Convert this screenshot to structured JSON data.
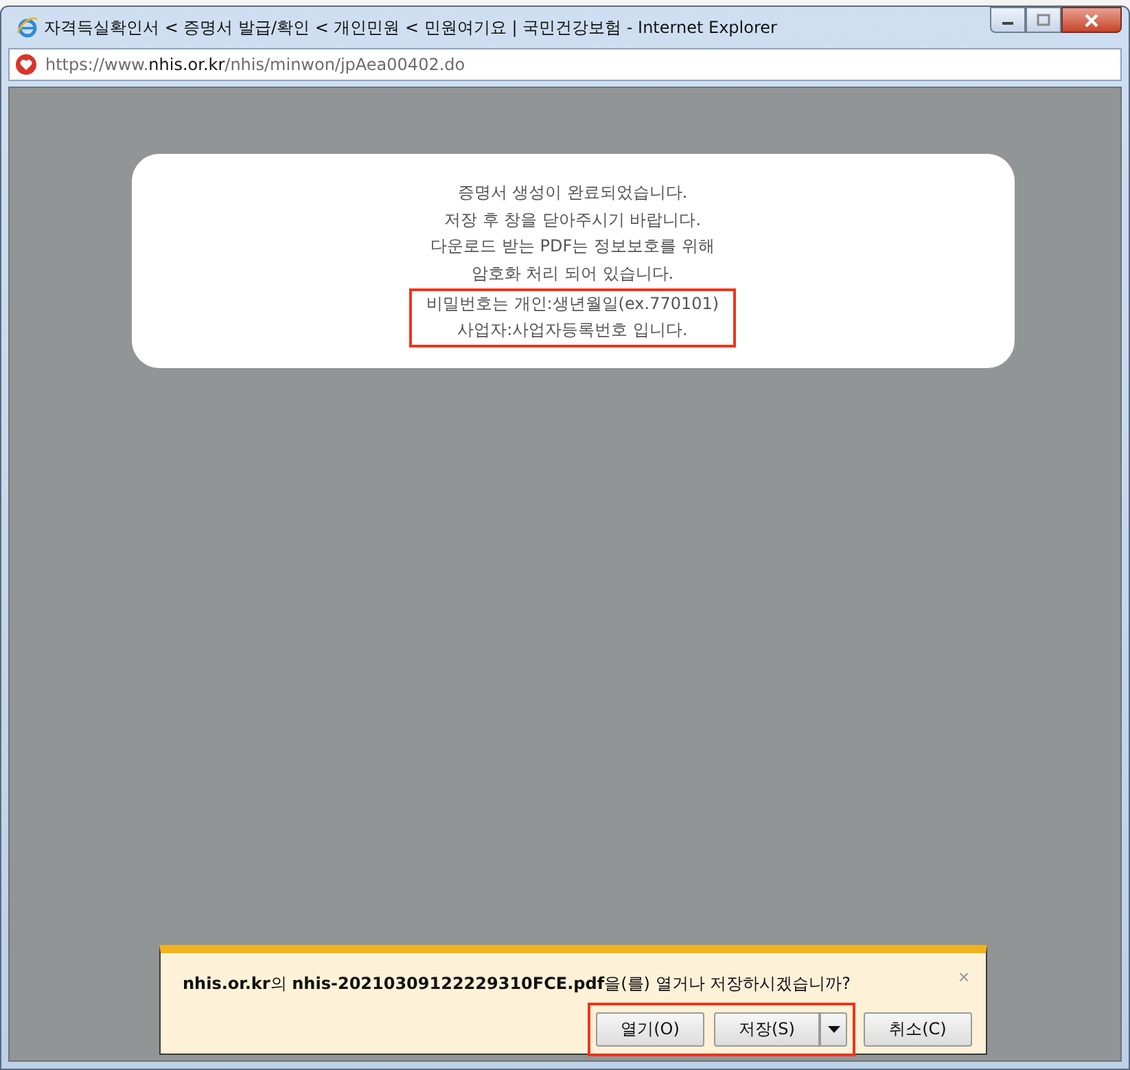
{
  "window": {
    "title": "자격득실확인서 < 증명서 발급/확인 < 개인민원 < 민원여기요 | 국민건강보험 - Internet Explorer"
  },
  "address_bar": {
    "url": "https://www.**nhis.or.kr**/nhis/minwon/jpAea00402.do"
  },
  "message": {
    "lines": [
      {
        "text": "증명서 생성이 완료되었습니다.",
        "highlighted": false
      },
      {
        "text": "저장 후 창을 닫아주시기 바랍니다.",
        "highlighted": false
      },
      {
        "text": "다운로드 받는 PDF는 정보보호를 위해",
        "highlighted": false
      },
      {
        "text": "암호화 처리 되어 있습니다.",
        "highlighted": false
      },
      {
        "text": "비밀번호는 개인:생년월일(ex.770101)",
        "highlighted": true
      },
      {
        "text": "사업자:사업자등록번호 입니다.",
        "highlighted": true
      }
    ]
  },
  "download_bar": {
    "prompt": "**nhis.or.kr**의 **nhis-20210309122229310FCE.pdf**을(를) 열거나 저장하시겠습니까?",
    "close": "×",
    "buttons": [
      {
        "label": "열기(O)",
        "kind": "plain",
        "highlighted": true
      },
      {
        "label": "저장(S)",
        "kind": "split",
        "highlighted": true
      },
      {
        "label": "취소(C)",
        "kind": "plain",
        "highlighted": false
      }
    ]
  }
}
